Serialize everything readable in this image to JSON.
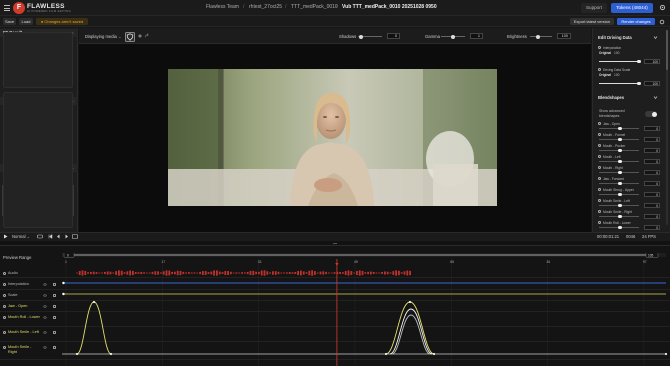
{
  "app": {
    "brand": "FLAWLESS",
    "brand_sub": "AI POWERED FILM EDITING",
    "logo_letter": "F",
    "breadcrumb": [
      "Flawless Team",
      "rhtest_27oct25",
      "TTT_medPack_0010",
      "Vub TTT_medPack_0010 20251028 0950"
    ],
    "support_label": "Support",
    "tokens_label": "Tokens (48044)"
  },
  "toolbar": {
    "save_label": "Save",
    "load_label": "Load",
    "changes_label": "Changes aren't saved",
    "export_label": "Export latest version",
    "render_label": "Render changes"
  },
  "left_panel": {
    "sections": [
      "FT Result",
      "Driving Data",
      "Plate Proxy"
    ]
  },
  "video_toolbar": {
    "mode_label": "Displaying media",
    "shadows_label": "Shadows",
    "shadows_value": "0",
    "gamma_label": "Gamma",
    "gamma_value": "1",
    "brightness_label": "Brightness",
    "brightness_value": "100"
  },
  "right_panel": {
    "edit_title": "Edit Driving Data",
    "interp_label": "Interpolation",
    "interp_scale_label": "Original",
    "interp_scale_max": "100",
    "interp_value": "100",
    "scale_label": "Driving Data Scale",
    "scale_scale_label": "Original",
    "scale_scale_max": "100",
    "scale_value": "100",
    "blendshapes_title": "Blendshapes",
    "advanced_label": "Show advanced blendshapes",
    "blendshapes": [
      {
        "name": "Jaw - Open",
        "value": "0"
      },
      {
        "name": "Mouth - Funnel",
        "value": "0"
      },
      {
        "name": "Mouth - Pucker",
        "value": "0"
      },
      {
        "name": "Mouth - Left",
        "value": "0"
      },
      {
        "name": "Mouth - Right",
        "value": "0"
      },
      {
        "name": "Jaw - Forward",
        "value": "0"
      },
      {
        "name": "Mouth Shrug - Upper",
        "value": "0"
      },
      {
        "name": "Mouth Smile - Left",
        "value": "0"
      },
      {
        "name": "Mouth Smile - Right",
        "value": "0"
      },
      {
        "name": "Mouth Roll - Lower",
        "value": "0"
      }
    ]
  },
  "playback": {
    "speed_label": "Normal",
    "timecode": "00:00:01:21",
    "frame": "0046",
    "fps": "24 FPS"
  },
  "timeline": {
    "preview_label": "Preview Range",
    "range_start": "0",
    "range_end": "105",
    "ruler": [
      "1",
      "17",
      "33",
      "49",
      "65",
      "81",
      "97"
    ],
    "tracks": [
      "Audio",
      "Interpolation",
      "Scale",
      "Jaw - Open",
      "Mouth Roll - Lower",
      "Mouth Smile - Left",
      "Mouth Smile - Right"
    ]
  },
  "colors": {
    "accent_blue": "#2d5fd3",
    "warning": "#e0a430",
    "audio": "#c0302c",
    "curve_yellow": "#e4df6c",
    "curve_white": "#f2f2f2",
    "playhead": "#d9372b",
    "interp_line": "#3a66d8"
  }
}
